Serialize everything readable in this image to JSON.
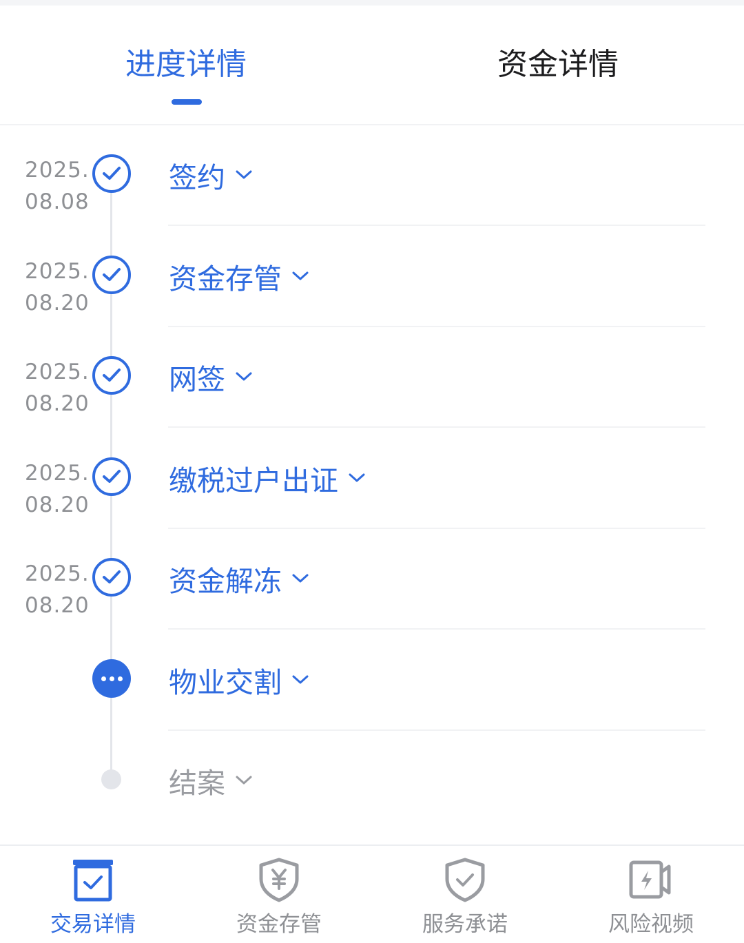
{
  "tabs": {
    "progress_label": "进度详情",
    "funds_label": "资金详情"
  },
  "steps": [
    {
      "title": "签约",
      "date_year": "2025.",
      "date_day": "08.08",
      "status": "done"
    },
    {
      "title": "资金存管",
      "date_year": "2025.",
      "date_day": "08.20",
      "status": "done"
    },
    {
      "title": "网签",
      "date_year": "2025.",
      "date_day": "08.20",
      "status": "done"
    },
    {
      "title": "缴税过户出证",
      "date_year": "2025.",
      "date_day": "08.20",
      "status": "done"
    },
    {
      "title": "资金解冻",
      "date_year": "2025.",
      "date_day": "08.20",
      "status": "done"
    },
    {
      "title": "物业交割",
      "date_year": "",
      "date_day": "",
      "status": "current"
    },
    {
      "title": "结案",
      "date_year": "",
      "date_day": "",
      "status": "pending"
    }
  ],
  "bottom_nav": [
    {
      "label": "交易详情",
      "icon": "clipboard-check-icon",
      "active": true
    },
    {
      "label": "资金存管",
      "icon": "shield-yuan-icon",
      "active": false
    },
    {
      "label": "服务承诺",
      "icon": "shield-check-icon",
      "active": false
    },
    {
      "label": "风险视频",
      "icon": "video-lightning-icon",
      "active": false
    }
  ],
  "colors": {
    "accent": "#2f6bdf",
    "muted_text": "#8e9094",
    "inactive_icon": "#9a9ca1"
  }
}
